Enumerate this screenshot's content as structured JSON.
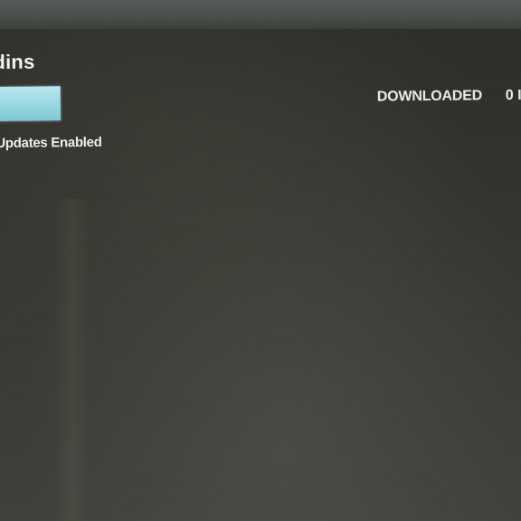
{
  "addons_panel": {
    "title": "dins",
    "status": "Updates Enabled",
    "downloaded_label": "DOWNLOADED",
    "downloaded_count": "0 I"
  },
  "colors": {
    "screen_background": "#2f302e",
    "accent_button": "#98d7e2",
    "text": "#eceeea"
  }
}
